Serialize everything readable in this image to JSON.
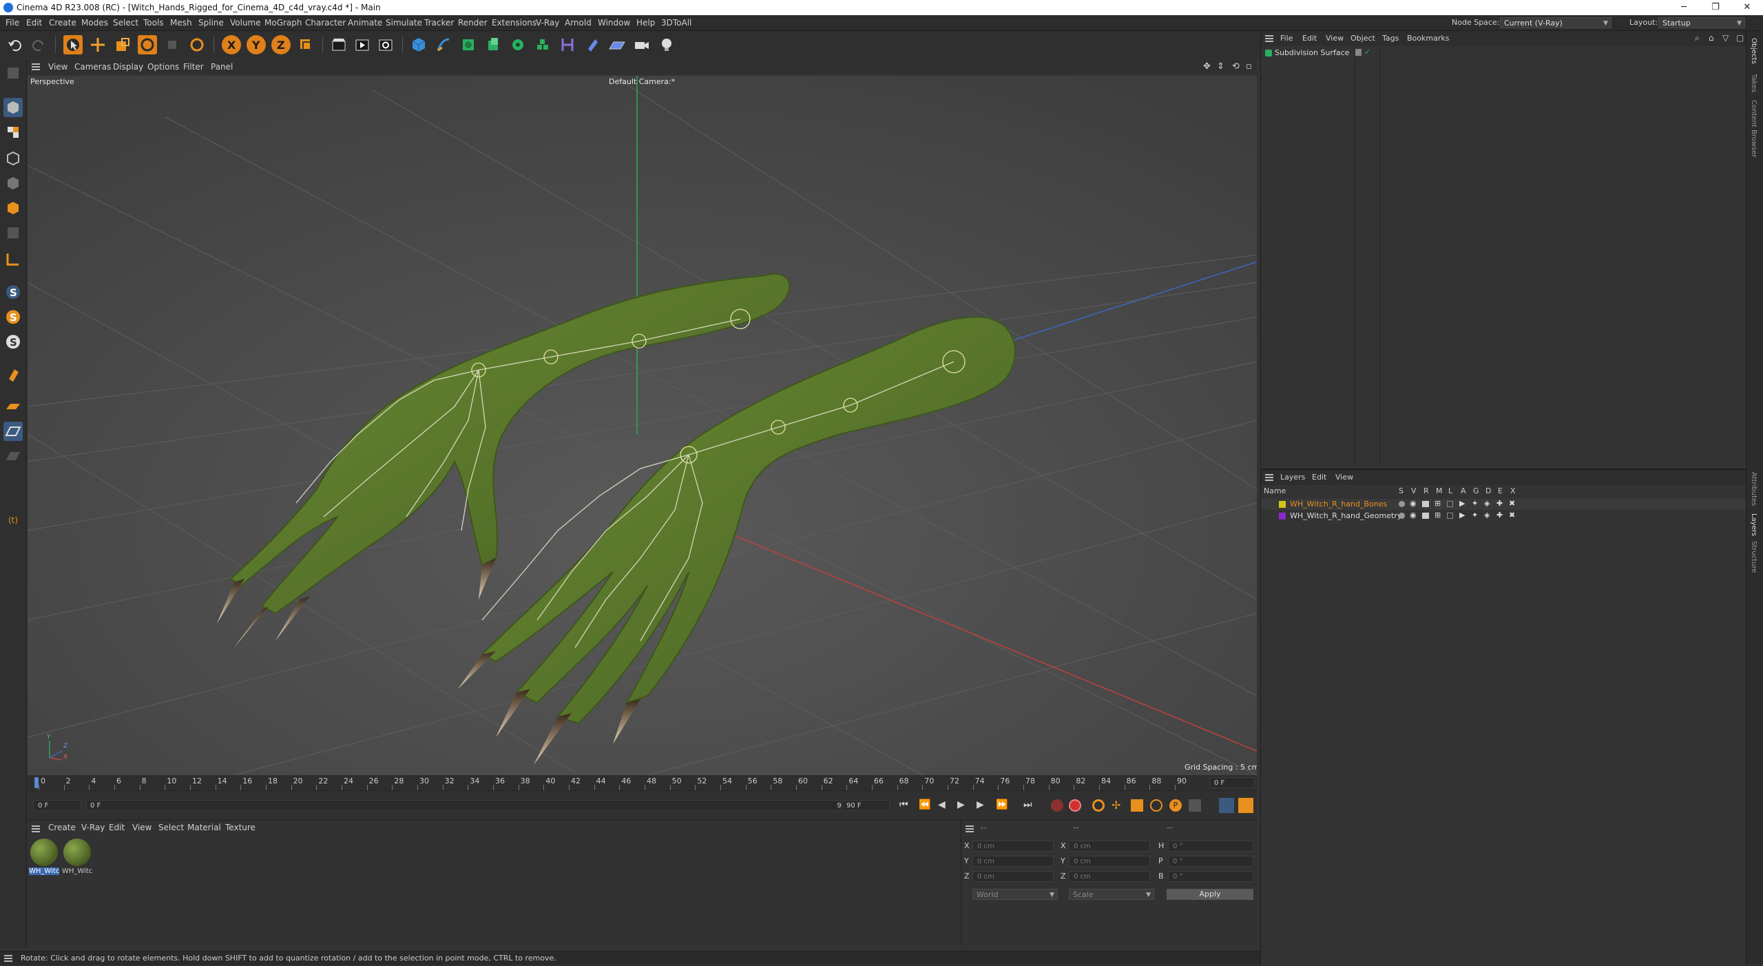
{
  "window": {
    "title": "Cinema 4D R23.008 (RC) - [Witch_Hands_Rigged_for_Cinema_4D_c4d_vray.c4d *] - Main",
    "minimize": "─",
    "maximize": "❐",
    "close": "✕"
  },
  "menubar": {
    "items": [
      "File",
      "Edit",
      "Create",
      "Modes",
      "Select",
      "Tools",
      "Mesh",
      "Spline",
      "Volume",
      "MoGraph",
      "Character",
      "Animate",
      "Simulate",
      "Tracker",
      "Render",
      "Extensions",
      "V-Ray",
      "Arnold",
      "Window",
      "Help",
      "3DToAll"
    ],
    "node_space_label": "Node Space:",
    "node_space_value": "Current (V-Ray)",
    "layout_label": "Layout:",
    "layout_value": "Startup"
  },
  "viewport": {
    "menu": [
      "View",
      "Cameras",
      "Display",
      "Options",
      "Filter",
      "Panel"
    ],
    "projection": "Perspective",
    "camera": "Default Camera",
    "camera_suffix": ":*",
    "grid_spacing": "Grid Spacing : 5 cm",
    "axis_y": "Y",
    "axis_z": "Z",
    "axis_x": "X"
  },
  "timeline": {
    "ticks": [
      "0",
      "2",
      "4",
      "6",
      "8",
      "10",
      "12",
      "14",
      "16",
      "18",
      "20",
      "22",
      "24",
      "26",
      "28",
      "30",
      "32",
      "34",
      "36",
      "38",
      "40",
      "42",
      "44",
      "46",
      "48",
      "50",
      "52",
      "54",
      "56",
      "58",
      "60",
      "62",
      "64",
      "66",
      "68",
      "70",
      "72",
      "74",
      "76",
      "78",
      "80",
      "82",
      "84",
      "86",
      "88",
      "90"
    ],
    "current_frame": "0 F",
    "start_field": "0 F",
    "range_start": "0 F",
    "range_end": "90 F",
    "end_field": "90 F"
  },
  "material_manager": {
    "menu": [
      "Create",
      "V-Ray",
      "Edit",
      "View",
      "Select",
      "Material",
      "Texture"
    ],
    "materials": [
      {
        "label": "WH_Witc"
      },
      {
        "label": "WH_Witc"
      }
    ]
  },
  "coordinates": {
    "header_left": "--",
    "header_mid": "--",
    "header_right": "--",
    "pos_x_label": "X",
    "pos_x": "0 cm",
    "pos_y_label": "Y",
    "pos_y": "0 cm",
    "pos_z_label": "Z",
    "pos_z": "0 cm",
    "size_x_label": "X",
    "size_x": "0 cm",
    "size_y_label": "Y",
    "size_y": "0 cm",
    "size_z_label": "Z",
    "size_z": "0 cm",
    "rot_h_label": "H",
    "rot_h": "0 °",
    "rot_p_label": "P",
    "rot_p": "0 °",
    "rot_b_label": "B",
    "rot_b": "0 °",
    "world": "World",
    "scale": "Scale",
    "apply": "Apply"
  },
  "status": {
    "text": "Rotate: Click and drag to rotate elements. Hold down SHIFT to add to quantize rotation / add to the selection in point mode, CTRL to remove."
  },
  "objects_panel": {
    "menu": [
      "File",
      "Edit",
      "View",
      "Object",
      "Tags",
      "Bookmarks"
    ],
    "items": [
      {
        "name": "Subdivision Surface"
      }
    ]
  },
  "layers_panel": {
    "menu": [
      "Layers",
      "Edit",
      "View"
    ],
    "columns": [
      "Name",
      "S",
      "V",
      "R",
      "M",
      "L",
      "A",
      "G",
      "D",
      "E",
      "X"
    ],
    "layers": [
      {
        "name": "WH_Witch_R_hand_Bones",
        "color": "#d8c21a"
      },
      {
        "name": "WH_Witch_R_hand_Geometry",
        "color": "#8a2ac8"
      }
    ]
  },
  "side_tabs": [
    "Objects",
    "Takes",
    "Content Browser",
    "Attributes",
    "Layers",
    "Structure"
  ],
  "colors": {
    "accent_orange": "#e0801a",
    "accent_blue": "#3a8fd8",
    "grid_bg": "#4c4c4c",
    "skin": "#5e7a2a"
  }
}
